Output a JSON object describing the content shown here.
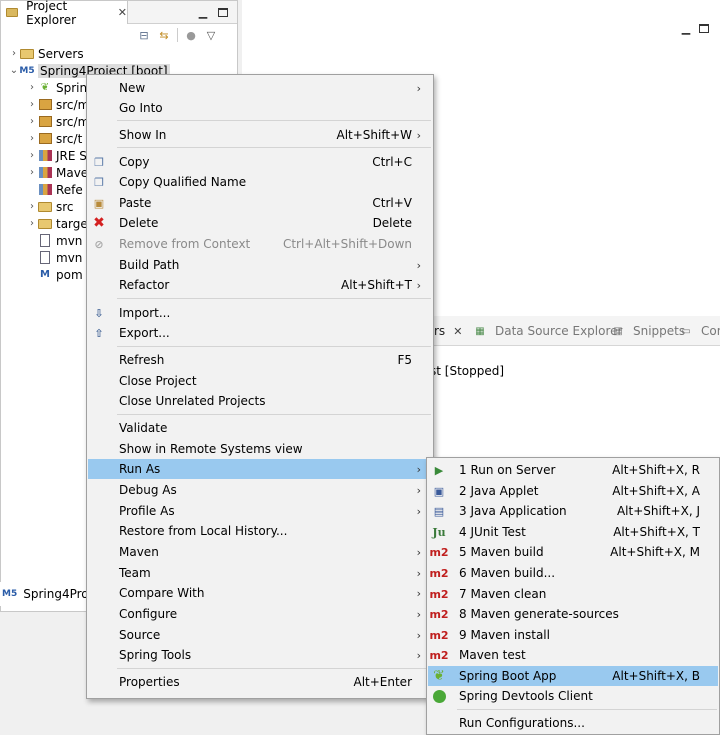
{
  "project_explorer": {
    "tab_title": "Project Explorer",
    "tab_close": "✕",
    "tree": [
      {
        "label": "Servers",
        "indent": 1
      },
      {
        "label": "Spring4Project [boot]",
        "indent": 0
      },
      {
        "label": "Sprin",
        "indent": 2
      },
      {
        "label": "src/m",
        "indent": 2
      },
      {
        "label": "src/m",
        "indent": 2
      },
      {
        "label": "src/t",
        "indent": 2
      },
      {
        "label": "JRE S",
        "indent": 2
      },
      {
        "label": "Mave",
        "indent": 2
      },
      {
        "label": "Refe",
        "indent": 2
      },
      {
        "label": "src",
        "indent": 2
      },
      {
        "label": "targe",
        "indent": 2
      },
      {
        "label": "mvn",
        "indent": 2
      },
      {
        "label": "mvn",
        "indent": 2
      },
      {
        "label": "pom",
        "indent": 2
      }
    ]
  },
  "bottom_left_tab": {
    "label": "Spring4Projec"
  },
  "lower_panel": {
    "tabs": [
      "rs",
      "Data Source Explorer",
      "Snippets",
      "Cons"
    ],
    "server_status": "st  [Stopped]"
  },
  "context_menu": {
    "items": [
      {
        "label": "New",
        "shortcut": "",
        "submenu": true
      },
      {
        "label": "Go Into",
        "shortcut": "",
        "submenu": false
      },
      {
        "label": "Show In",
        "shortcut": "Alt+Shift+W",
        "submenu": true
      },
      {
        "label": "Copy",
        "shortcut": "Ctrl+C",
        "submenu": false
      },
      {
        "label": "Copy Qualified Name",
        "shortcut": "",
        "submenu": false
      },
      {
        "label": "Paste",
        "shortcut": "Ctrl+V",
        "submenu": false
      },
      {
        "label": "Delete",
        "shortcut": "Delete",
        "submenu": false
      },
      {
        "label": "Remove from Context",
        "shortcut": "Ctrl+Alt+Shift+Down",
        "submenu": false,
        "disabled": true
      },
      {
        "label": "Build Path",
        "shortcut": "",
        "submenu": true
      },
      {
        "label": "Refactor",
        "shortcut": "Alt+Shift+T",
        "submenu": true
      },
      {
        "label": "Import...",
        "shortcut": "",
        "submenu": false
      },
      {
        "label": "Export...",
        "shortcut": "",
        "submenu": false
      },
      {
        "label": "Refresh",
        "shortcut": "F5",
        "submenu": false
      },
      {
        "label": "Close Project",
        "shortcut": "",
        "submenu": false
      },
      {
        "label": "Close Unrelated Projects",
        "shortcut": "",
        "submenu": false
      },
      {
        "label": "Validate",
        "shortcut": "",
        "submenu": false
      },
      {
        "label": "Show in Remote Systems view",
        "shortcut": "",
        "submenu": false
      },
      {
        "label": "Run As",
        "shortcut": "",
        "submenu": true,
        "selected": true
      },
      {
        "label": "Debug As",
        "shortcut": "",
        "submenu": true
      },
      {
        "label": "Profile As",
        "shortcut": "",
        "submenu": true
      },
      {
        "label": "Restore from Local History...",
        "shortcut": "",
        "submenu": false
      },
      {
        "label": "Maven",
        "shortcut": "",
        "submenu": true
      },
      {
        "label": "Team",
        "shortcut": "",
        "submenu": true
      },
      {
        "label": "Compare With",
        "shortcut": "",
        "submenu": true
      },
      {
        "label": "Configure",
        "shortcut": "",
        "submenu": true
      },
      {
        "label": "Source",
        "shortcut": "",
        "submenu": true
      },
      {
        "label": "Spring Tools",
        "shortcut": "",
        "submenu": true
      },
      {
        "label": "Properties",
        "shortcut": "Alt+Enter",
        "submenu": false
      }
    ]
  },
  "run_as_submenu": {
    "items": [
      {
        "label": "1 Run on Server",
        "shortcut": "Alt+Shift+X, R"
      },
      {
        "label": "2 Java Applet",
        "shortcut": "Alt+Shift+X, A"
      },
      {
        "label": "3 Java Application",
        "shortcut": "Alt+Shift+X, J"
      },
      {
        "label": "4 JUnit Test",
        "shortcut": "Alt+Shift+X, T"
      },
      {
        "label": "5 Maven build",
        "shortcut": "Alt+Shift+X, M"
      },
      {
        "label": "6 Maven build...",
        "shortcut": ""
      },
      {
        "label": "7 Maven clean",
        "shortcut": ""
      },
      {
        "label": "8 Maven generate-sources",
        "shortcut": ""
      },
      {
        "label": "9 Maven install",
        "shortcut": ""
      },
      {
        "label": "Maven test",
        "shortcut": ""
      },
      {
        "label": "Spring Boot App",
        "shortcut": "Alt+Shift+X, B",
        "selected": true
      },
      {
        "label": "Spring Devtools Client",
        "shortcut": ""
      },
      {
        "label": "Run Configurations...",
        "shortcut": ""
      }
    ],
    "m2_badge": "m2",
    "junit_badge": "Ju"
  },
  "colors": {
    "selection": "#99c9ef",
    "menu_bg": "#f2f2f2"
  }
}
